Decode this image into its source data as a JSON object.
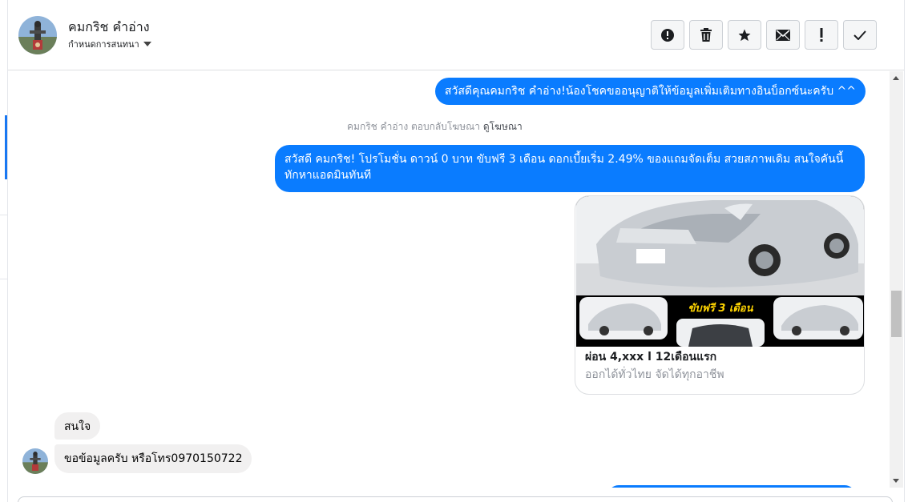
{
  "header": {
    "contact_name": "คมกริช คำอ่าง",
    "convo_setting_label": "กำหนดการสนทนา",
    "toolbar": [
      {
        "name": "spam-button",
        "icon": "alert-circle-icon"
      },
      {
        "name": "delete-button",
        "icon": "trash-icon"
      },
      {
        "name": "star-button",
        "icon": "star-icon"
      },
      {
        "name": "mark-unread-button",
        "icon": "envelope-icon"
      },
      {
        "name": "important-button",
        "icon": "exclamation-icon"
      },
      {
        "name": "done-button",
        "icon": "check-icon"
      }
    ]
  },
  "messages": {
    "out_greeting": "สวัสดีคุณคมกริช คำอ่าง!น้องโชคขออนุญาติให้ข้อมูลเพิ่มเติมทางอินบ็อกซ์นะครับ ^^",
    "reply_note_prefix": "คมกริช คำอ่าง ตอบกลับโฆษณา",
    "reply_note_link": "ดูโฆษณา",
    "out_promo": "สวัสดี คมกริช! โปรโมชั่น ดาวน์ 0 บาท ขับฟรี 3 เดือน ดอกเบี้ยเริ่ม 2.49% ของแถมจัดเต็ม สวยสภาพเดิม สนใจคันนี้ทักหาแอดมินทันที",
    "card": {
      "banner_text": "ขับฟรี 3 เดือน",
      "title": "ผ่อน 4,xxx l 12เดือนแรก",
      "subtitle": "ออกได้ทั่วไทย จัดได้ทุกอาชีพ"
    },
    "in_interest": "สนใจ",
    "in_request": "ขอข้อมูลครับ หรือโทร0970150722"
  },
  "colors": {
    "outgoing_bubble": "#0a7cff",
    "incoming_bubble": "#f1f0f0",
    "car_silver": "#c9cdd2",
    "banner_yellow": "#ffd400"
  }
}
